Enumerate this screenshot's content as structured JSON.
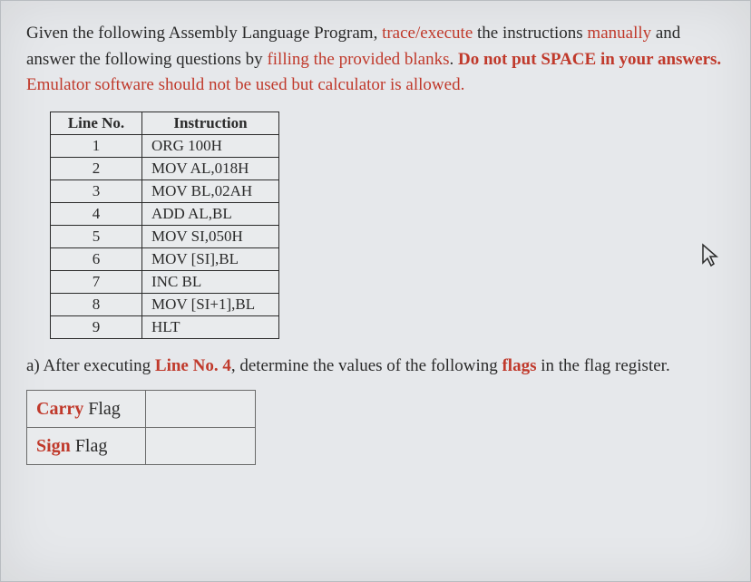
{
  "intro": {
    "p1_a": "Given the following Assembly Language Program, ",
    "p1_b": "trace/execute",
    "p1_c": " the instructions ",
    "p1_d": "manually",
    "p1_e": " and answer the following questions by ",
    "p1_f": "filling the provided blanks",
    "p1_g": ". ",
    "p1_h": "Do not put SPACE in your answers.",
    "p1_i": "  Emulator software should not be used but calculator is allowed."
  },
  "table": {
    "header_line": "Line No.",
    "header_ins": "Instruction",
    "rows": [
      {
        "n": "1",
        "ins": "ORG 100H"
      },
      {
        "n": "2",
        "ins": "MOV AL,018H"
      },
      {
        "n": "3",
        "ins": "MOV BL,02AH"
      },
      {
        "n": "4",
        "ins": "ADD AL,BL"
      },
      {
        "n": "5",
        "ins": "MOV SI,050H"
      },
      {
        "n": "6",
        "ins": "MOV [SI],BL"
      },
      {
        "n": "7",
        "ins": "INC BL"
      },
      {
        "n": "8",
        "ins": "MOV [SI+1],BL"
      },
      {
        "n": "9",
        "ins": "HLT"
      }
    ]
  },
  "question": {
    "a": "a) After executing ",
    "b": "Line No. 4",
    "c": ", determine the values of the following ",
    "d": "flags",
    "e": " in the flag register."
  },
  "flags": {
    "carry_em": "Carry",
    "carry_rest": " Flag",
    "sign_em": "Sign",
    "sign_rest": " Flag",
    "carry_val": "",
    "sign_val": ""
  }
}
